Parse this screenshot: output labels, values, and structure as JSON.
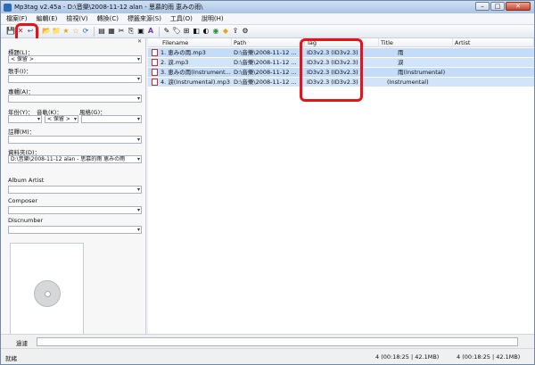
{
  "window": {
    "title": "Mp3tag v2.45a - D:\\音樂\\2008-11-12 alan - 思慕的雨 恵みの雨\\",
    "buttons": {
      "minimize": "–",
      "maximize": "□",
      "close": "✕"
    }
  },
  "menubar": {
    "items": [
      "檔案(F)",
      "編輯(E)",
      "檢視(V)",
      "轉換(C)",
      "標籤來源(S)",
      "工具(O)",
      "說明(H)"
    ]
  },
  "toolbar": {
    "icons": [
      "save-icon",
      "remove-icon",
      "undo-icon",
      "open-folder-icon",
      "add-folder-icon",
      "favorite-icon",
      "star-icon",
      "refresh-icon",
      "mp3-icon",
      "actions-icon",
      "cut-icon",
      "copy-icon",
      "paste-icon",
      "text-icon",
      "edit-icon",
      "tag-icon",
      "split-icon",
      "freedb-icon",
      "discogs-icon",
      "web-icon",
      "amazon-icon",
      "export-icon",
      "settings-icon"
    ],
    "glyphs": [
      "💾",
      "✕",
      "↩",
      "📂",
      "📁",
      "★",
      "☆",
      "⟳",
      "▤",
      "▦",
      "✂",
      "⎘",
      "▣",
      "A",
      "✎",
      "🏷",
      "⊞",
      "◧",
      "◐",
      "◉",
      "◆",
      "⇪",
      "⚙"
    ],
    "highlight_color": "#e5141b"
  },
  "left_panel": {
    "close_glyph": "✕",
    "fields": [
      {
        "label": "標題(L)：",
        "value": "< 保留 >"
      },
      {
        "label": "歌手(I)：",
        "value": ""
      },
      {
        "label": "專輯(A)：",
        "value": ""
      },
      {
        "label": "年份(Y)：",
        "value": ""
      },
      {
        "label": "音軌(K)：",
        "value": "< 保留 >"
      },
      {
        "label": "風格(G)：",
        "value": ""
      },
      {
        "label": "註釋(M)：",
        "value": ""
      },
      {
        "label": "資料夾(D)：",
        "value": "D:\\音樂\\2008-11-12 alan - 思慕的雨 恵みの雨"
      },
      {
        "label": "Album Artist",
        "value": ""
      },
      {
        "label": "Composer",
        "value": ""
      },
      {
        "label": "Discnumber",
        "value": ""
      }
    ],
    "dropdown_glyph": "▾",
    "cover_icon": "disc-icon"
  },
  "file_list": {
    "columns": [
      "Filename",
      "Path",
      "Tag",
      "Title",
      "Artist"
    ],
    "rows": [
      {
        "filename": "1. 恵みの雨.mp3",
        "path": "D:\\音樂\\2008-11-12 ...",
        "tag": "ID3v2.3 (ID3v2.3)",
        "title": "雨"
      },
      {
        "filename": "2. 淚.mp3",
        "path": "D:\\音樂\\2008-11-12 ...",
        "tag": "ID3v2.3 (ID3v2.3)",
        "title": "淚"
      },
      {
        "filename": "3. 恵みの雨(Instrument...",
        "path": "D:\\音樂\\2008-11-12 ...",
        "tag": "ID3v2.3 (ID3v2.3)",
        "title": "雨(Instrumental)"
      },
      {
        "filename": "4. 淚(Instrumental).mp3",
        "path": "D:\\音樂\\2008-11-12 ...",
        "tag": "ID3v2.3 (ID3v2.3)",
        "title": "(Instrumental)"
      }
    ]
  },
  "filter": {
    "label": "過濾",
    "value": ""
  },
  "status": {
    "left": "就緒",
    "right_a": "4 (00:18:25 | 42.1MB)",
    "right_b": "4 (00:18:25 | 42.1MB)"
  }
}
